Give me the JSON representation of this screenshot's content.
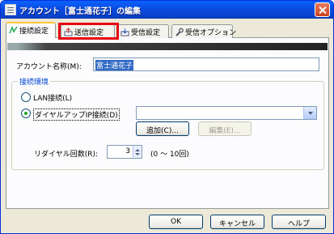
{
  "window": {
    "title": "アカウント［富士通花子］の編集"
  },
  "tabs": [
    {
      "label": "接続設定",
      "icon": "connection-icon"
    },
    {
      "label": "送信設定",
      "icon": "send-icon"
    },
    {
      "label": "受信設定",
      "icon": "receive-icon"
    },
    {
      "label": "受信オプション",
      "icon": "wrench-icon"
    }
  ],
  "account": {
    "label": "アカウント名称(M):",
    "value": "富士通花子"
  },
  "connection": {
    "group_title": "接続環境",
    "lan_label": "LAN接続(L)",
    "dialup_label": "ダイヤルアップIP接続(D)",
    "dialup_selected": true,
    "dialup_value": "",
    "add_button": "追加(C)...",
    "edit_button": "編集(E)...",
    "redial_label": "リダイヤル回数(R):",
    "redial_value": "3",
    "redial_range": "(0 ～ 10回)"
  },
  "footer": {
    "ok": "OK",
    "cancel": "キャンセル",
    "help": "ヘルプ"
  },
  "colors": {
    "highlight": "#e60012",
    "titlebar": "#0a4ce0"
  }
}
